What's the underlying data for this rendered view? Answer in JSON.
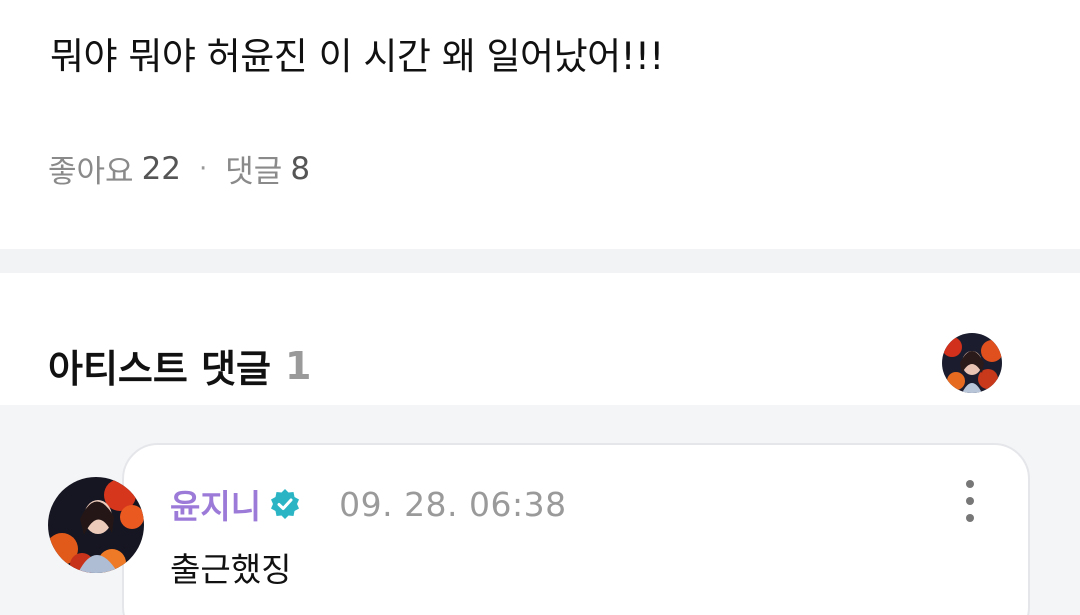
{
  "post": {
    "text": "뭐야 뭐야 허윤진 이 시간 왜 일어났어!!!",
    "likes_label": "좋아요",
    "likes_count": "22",
    "separator": "·",
    "comments_label": "댓글",
    "comments_count": "8"
  },
  "artist_comments": {
    "title": "아티스트 댓글",
    "count": "1",
    "avatar_icon": "artist-avatar",
    "items": [
      {
        "author": "윤지니",
        "verified_icon": "verified-badge-icon",
        "timestamp": "09. 28. 06:38",
        "text": "출근했징",
        "menu_icon": "more-vertical-icon"
      }
    ]
  },
  "colors": {
    "author_name": "#9b7ad8",
    "verified_badge": "#2bb5c4",
    "muted_text": "#8a8a8a",
    "divider": "#f2f3f5",
    "comment_area_bg": "#f4f5f7"
  }
}
